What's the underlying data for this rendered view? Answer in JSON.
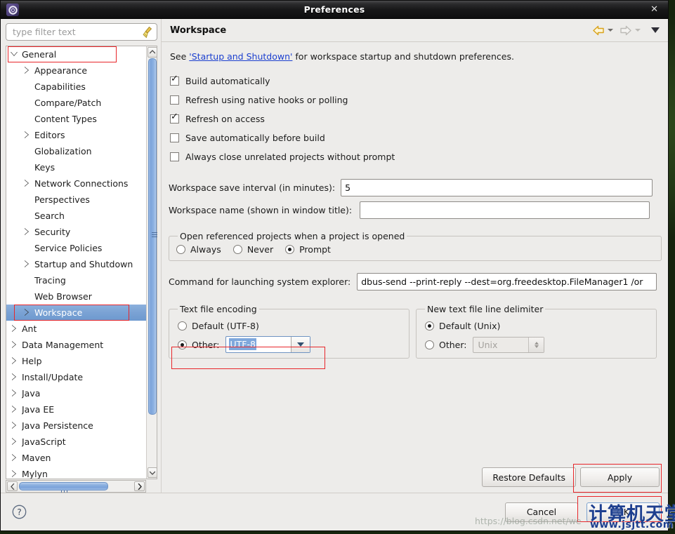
{
  "window": {
    "title": "Preferences",
    "app_icon": "gear-icon",
    "close_label": "✕"
  },
  "sidebar": {
    "filter": {
      "value": "",
      "placeholder": "type filter text",
      "clear_icon": "broom-icon"
    },
    "items": [
      {
        "label": "General",
        "indent": 0,
        "arrow": "expanded",
        "selected": false,
        "highlighted": true
      },
      {
        "label": "Appearance",
        "indent": 1,
        "arrow": "collapsed",
        "selected": false,
        "highlighted": false
      },
      {
        "label": "Capabilities",
        "indent": 1,
        "arrow": "none",
        "selected": false,
        "highlighted": false
      },
      {
        "label": "Compare/Patch",
        "indent": 1,
        "arrow": "none",
        "selected": false,
        "highlighted": false
      },
      {
        "label": "Content Types",
        "indent": 1,
        "arrow": "none",
        "selected": false,
        "highlighted": false
      },
      {
        "label": "Editors",
        "indent": 1,
        "arrow": "collapsed",
        "selected": false,
        "highlighted": false
      },
      {
        "label": "Globalization",
        "indent": 1,
        "arrow": "none",
        "selected": false,
        "highlighted": false
      },
      {
        "label": "Keys",
        "indent": 1,
        "arrow": "none",
        "selected": false,
        "highlighted": false
      },
      {
        "label": "Network Connections",
        "indent": 1,
        "arrow": "collapsed",
        "selected": false,
        "highlighted": false
      },
      {
        "label": "Perspectives",
        "indent": 1,
        "arrow": "none",
        "selected": false,
        "highlighted": false
      },
      {
        "label": "Search",
        "indent": 1,
        "arrow": "none",
        "selected": false,
        "highlighted": false
      },
      {
        "label": "Security",
        "indent": 1,
        "arrow": "collapsed",
        "selected": false,
        "highlighted": false
      },
      {
        "label": "Service Policies",
        "indent": 1,
        "arrow": "none",
        "selected": false,
        "highlighted": false
      },
      {
        "label": "Startup and Shutdown",
        "indent": 1,
        "arrow": "collapsed",
        "selected": false,
        "highlighted": false
      },
      {
        "label": "Tracing",
        "indent": 1,
        "arrow": "none",
        "selected": false,
        "highlighted": false
      },
      {
        "label": "Web Browser",
        "indent": 1,
        "arrow": "none",
        "selected": false,
        "highlighted": false
      },
      {
        "label": "Workspace",
        "indent": 1,
        "arrow": "collapsed",
        "selected": true,
        "highlighted": true
      },
      {
        "label": "Ant",
        "indent": 0,
        "arrow": "collapsed",
        "selected": false,
        "highlighted": false
      },
      {
        "label": "Data Management",
        "indent": 0,
        "arrow": "collapsed",
        "selected": false,
        "highlighted": false
      },
      {
        "label": "Help",
        "indent": 0,
        "arrow": "collapsed",
        "selected": false,
        "highlighted": false
      },
      {
        "label": "Install/Update",
        "indent": 0,
        "arrow": "collapsed",
        "selected": false,
        "highlighted": false
      },
      {
        "label": "Java",
        "indent": 0,
        "arrow": "collapsed",
        "selected": false,
        "highlighted": false
      },
      {
        "label": "Java EE",
        "indent": 0,
        "arrow": "collapsed",
        "selected": false,
        "highlighted": false
      },
      {
        "label": "Java Persistence",
        "indent": 0,
        "arrow": "collapsed",
        "selected": false,
        "highlighted": false
      },
      {
        "label": "JavaScript",
        "indent": 0,
        "arrow": "collapsed",
        "selected": false,
        "highlighted": false
      },
      {
        "label": "Maven",
        "indent": 0,
        "arrow": "collapsed",
        "selected": false,
        "highlighted": false
      },
      {
        "label": "Mylyn",
        "indent": 0,
        "arrow": "collapsed",
        "selected": false,
        "highlighted": false
      }
    ]
  },
  "panel": {
    "title": "Workspace",
    "nav": {
      "back_icon": "back-arrow-icon",
      "back_caret_icon": "chevron-down-icon",
      "forward_icon": "forward-arrow-icon",
      "forward_caret_icon": "chevron-down-icon",
      "menu_icon": "triangle-down-icon"
    },
    "intro": {
      "prefix": "See ",
      "link": "'Startup and Shutdown'",
      "suffix": " for workspace startup and shutdown preferences."
    },
    "checkboxes": [
      {
        "label": "Build automatically",
        "checked": true
      },
      {
        "label": "Refresh using native hooks or polling",
        "checked": false
      },
      {
        "label": "Refresh on access",
        "checked": true
      },
      {
        "label": "Save automatically before build",
        "checked": false
      },
      {
        "label": "Always close unrelated projects without prompt",
        "checked": false
      }
    ],
    "save_interval": {
      "label": "Workspace save interval (in minutes):",
      "value": "5"
    },
    "workspace_name": {
      "label": "Workspace name (shown in window title):",
      "value": ""
    },
    "open_referenced": {
      "legend": "Open referenced projects when a project is opened",
      "options": [
        {
          "label": "Always",
          "selected": false
        },
        {
          "label": "Never",
          "selected": false
        },
        {
          "label": "Prompt",
          "selected": true
        }
      ]
    },
    "explorer_command": {
      "label": "Command for launching system explorer:",
      "value": "dbus-send --print-reply --dest=org.freedesktop.FileManager1 /or"
    },
    "text_file_encoding": {
      "legend": "Text file encoding",
      "default_label": "Default (UTF-8)",
      "default_selected": false,
      "other_label": "Other:",
      "other_selected": true,
      "other_value": "UTF-8",
      "dropdown_icon": "chevron-down-icon"
    },
    "line_delimiter": {
      "legend": "New text file line delimiter",
      "default_label": "Default (Unix)",
      "default_selected": true,
      "other_label": "Other:",
      "other_selected": false,
      "other_value": "Unix",
      "spinner_icon": "up-down-spinner-icon"
    }
  },
  "buttons": {
    "restore_defaults": "Restore Defaults",
    "apply": "Apply",
    "cancel": "Cancel",
    "ok": "OK",
    "help_icon": "question-mark-icon"
  },
  "watermark": {
    "url": "https://blog.csdn.net/we",
    "chinese": "计算机天堂",
    "site": "www.jsjtt.com"
  },
  "colors": {
    "selection_blue": "#7aa2d4",
    "annotation_red": "#e8262a",
    "link_blue": "#1b3fcf",
    "titlebar_dark": "#171718",
    "panel_bg": "#edecea"
  }
}
